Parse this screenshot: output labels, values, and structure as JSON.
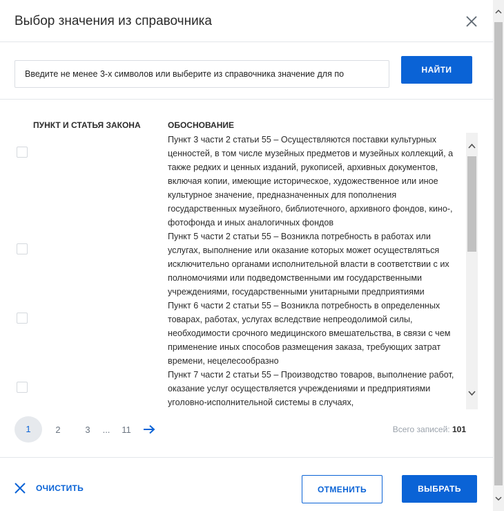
{
  "dialog": {
    "title": "Выбор значения из справочника"
  },
  "search": {
    "placeholder": "Введите не менее 3-х символов или выберите из справочника значение для по",
    "button_label": "НАЙТИ"
  },
  "table": {
    "columns": [
      "ПУНКТ И СТАТЬЯ ЗАКОНА",
      "ОБОСНОВАНИЕ"
    ],
    "rows": [
      {
        "checked": false,
        "point": "",
        "text": "Пункт 3 части 2 статьи 55 – Осуществляются поставки культурных ценностей, в том числе музейных предметов и музейных коллекций, а также редких и ценных изданий, рукописей, архивных документов, включая копии, имеющие историческое, художественное или иное культурное значение, предназначенных для пополнения государственных музейного, библиотечного, архивного фондов, кино-, фотофонда и иных аналогичных фондов"
      },
      {
        "checked": false,
        "point": "",
        "text": "Пункт 5 части 2 статьи 55 – Возникла потребность в работах или услугах, выполнение или оказание которых может осуществляться исключительно органами исполнительной власти в соответствии с их полномочиями или подведомственными им государственными учреждениями, государственными унитарными предприятиями"
      },
      {
        "checked": false,
        "point": "",
        "text": "Пункт 6 части 2 статьи 55 – Возникла потребность в определенных товарах, работах, услугах вследствие непреодолимой силы, необходимости срочного медицинского вмешательства, в связи с чем применение иных способов размещения заказа, требующих затрат времени, нецелесообразно"
      },
      {
        "checked": false,
        "point": "",
        "text": "Пункт 7 части 2 статьи 55 – Производство товаров, выполнение работ, оказание услуг осуществляется учреждениями и предприятиями уголовно-исполнительной системы в случаях,"
      }
    ]
  },
  "pagination": {
    "pages": [
      "1",
      "2",
      "3",
      "...",
      "11"
    ],
    "current": "1",
    "total_label": "Всего записей:",
    "total_value": "101"
  },
  "footer": {
    "clear_label": "ОЧИСТИТЬ",
    "cancel_label": "ОТМЕНИТЬ",
    "select_label": "ВЫБРАТЬ"
  },
  "colors": {
    "accent": "#0a63d6",
    "divider": "#e3e6ea",
    "muted_text": "#9aa2ab"
  }
}
